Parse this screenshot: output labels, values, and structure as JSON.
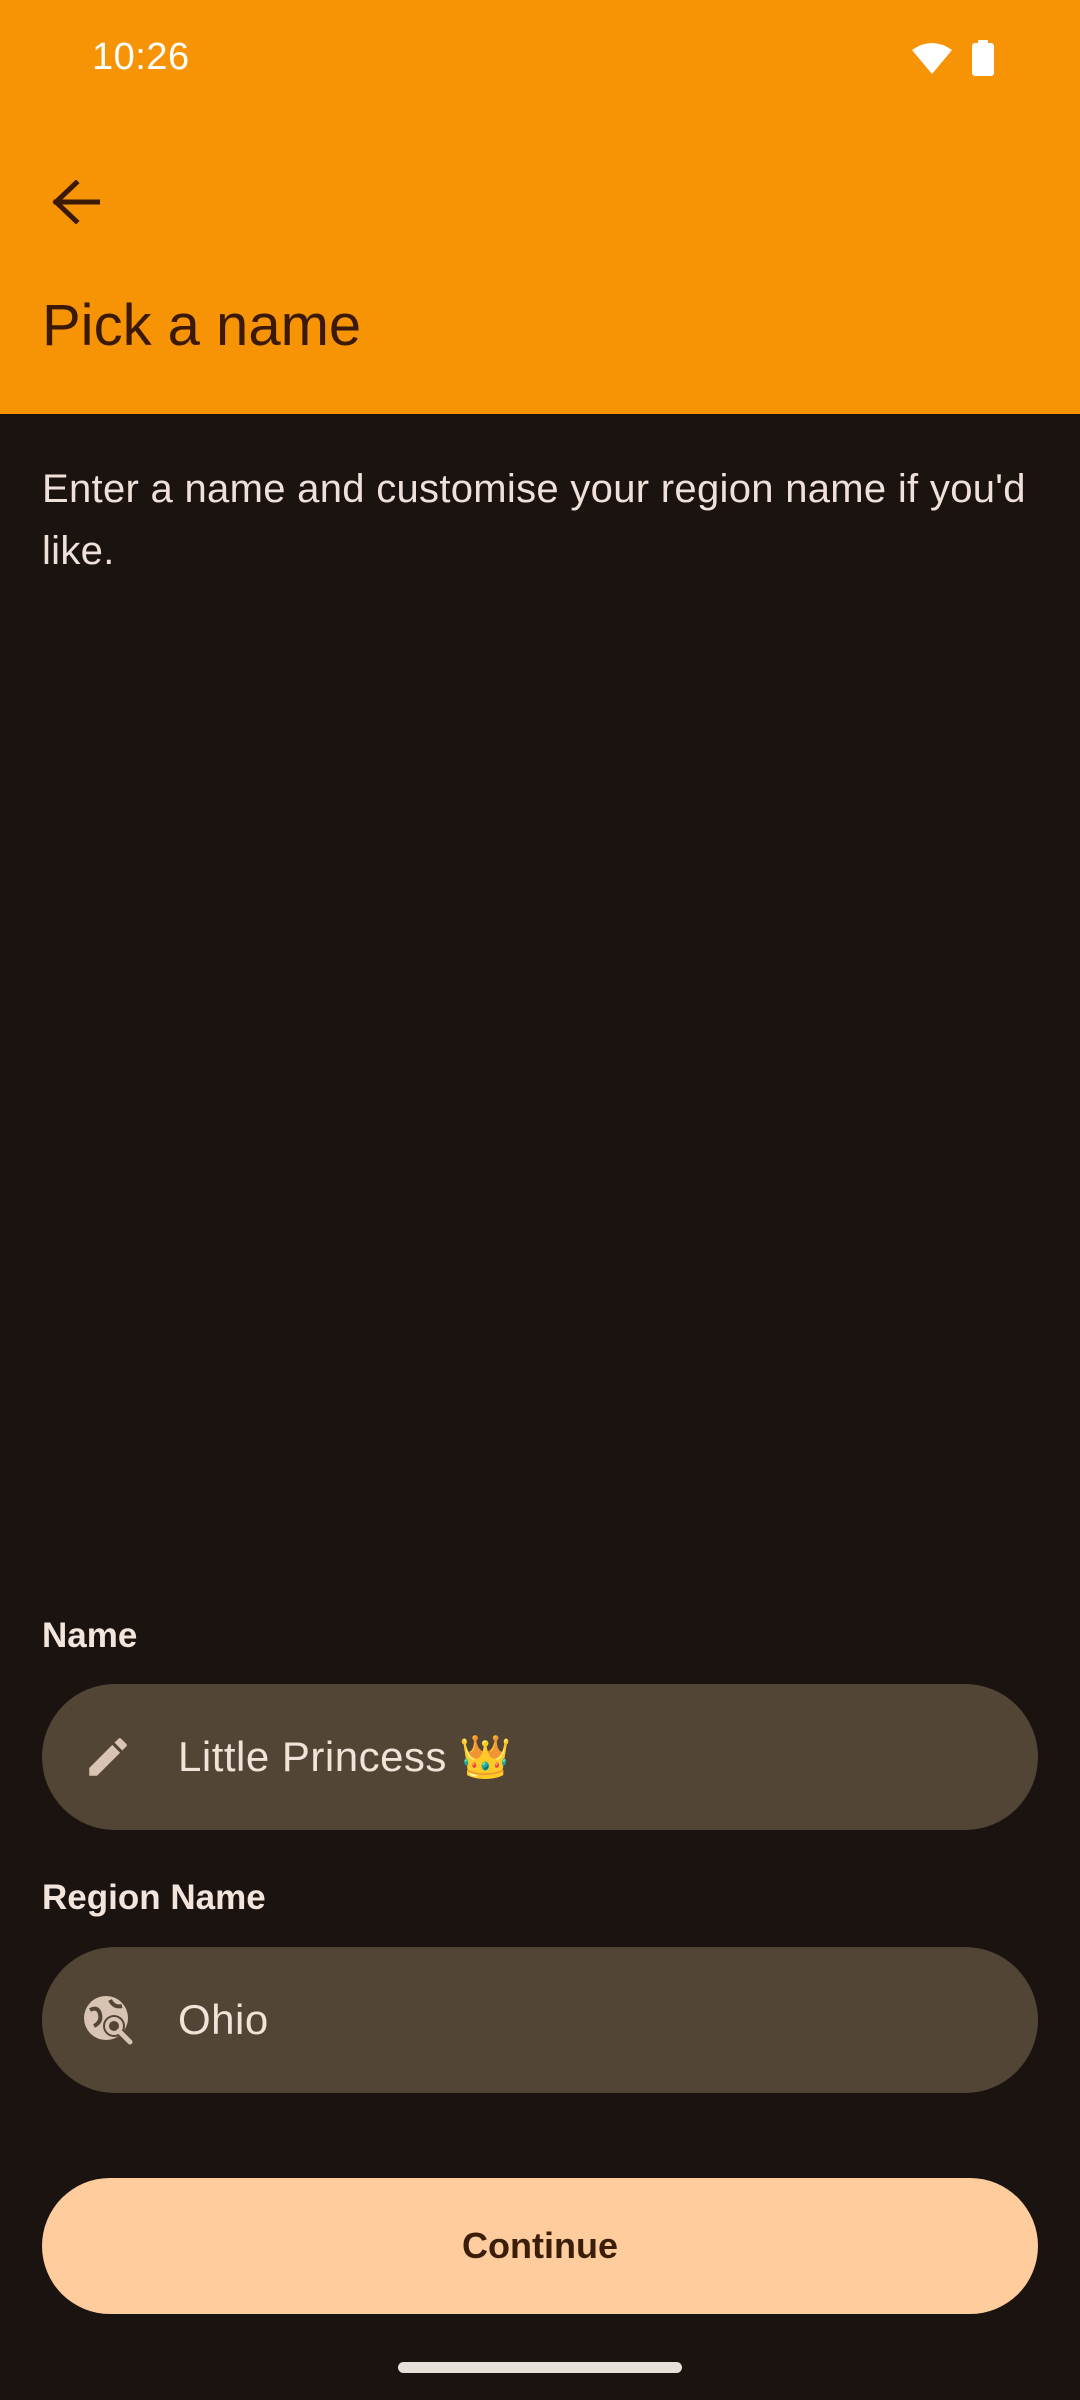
{
  "status_bar": {
    "time": "10:26",
    "wifi_icon": "wifi-icon",
    "battery_icon": "battery-icon"
  },
  "header": {
    "back_icon": "arrow-back-icon",
    "title": "Pick a name"
  },
  "main": {
    "description": "Enter a name and customise your region name if you'd like."
  },
  "name_field": {
    "label": "Name",
    "icon": "pencil-icon",
    "value": "Little Princess 👑"
  },
  "region_field": {
    "label": "Region Name",
    "icon": "globe-search-icon",
    "value": "Ohio"
  },
  "actions": {
    "continue_label": "Continue"
  },
  "colors": {
    "header": "#f79406",
    "background": "#1b1310",
    "field": "#534535",
    "button": "#ffcc9e"
  }
}
